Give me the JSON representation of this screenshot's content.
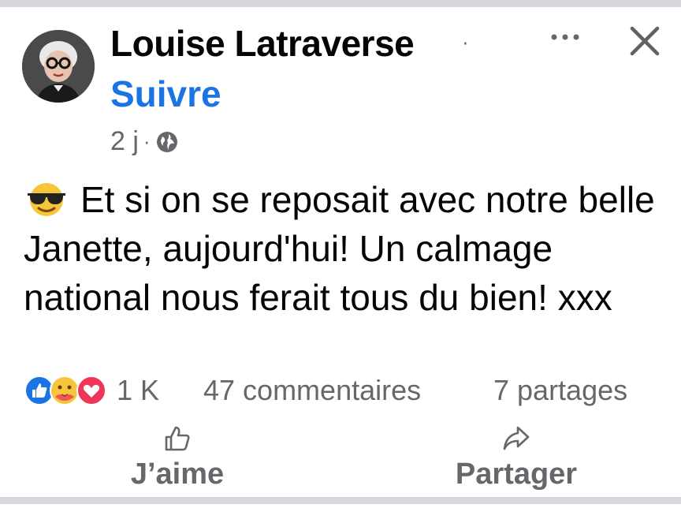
{
  "post": {
    "author": "Louise Latraverse",
    "separator": "·",
    "follow_label": "Suivre",
    "time": "2 j",
    "meta_separator": "·",
    "privacy_icon": "globe-icon",
    "text": "Et si on se reposait avec notre belle Janette, aujourd'hui! Un calmage national nous ferait tous du bien! xxx",
    "leading_emoji": "sunglasses-face-emoji"
  },
  "header": {
    "more_icon": "more-options-icon",
    "close_icon": "close-icon"
  },
  "engagement": {
    "reaction_icons": [
      "like-reaction-icon",
      "care-reaction-icon",
      "love-reaction-icon"
    ],
    "reaction_count": "1 K",
    "comments": "47 commentaires",
    "shares": "7 partages"
  },
  "actions": {
    "like_label": "J’aime",
    "share_label": "Partager"
  },
  "colors": {
    "accent": "#1b74e4",
    "secondary_text": "#65676b",
    "divider": "#d6d8dc"
  }
}
